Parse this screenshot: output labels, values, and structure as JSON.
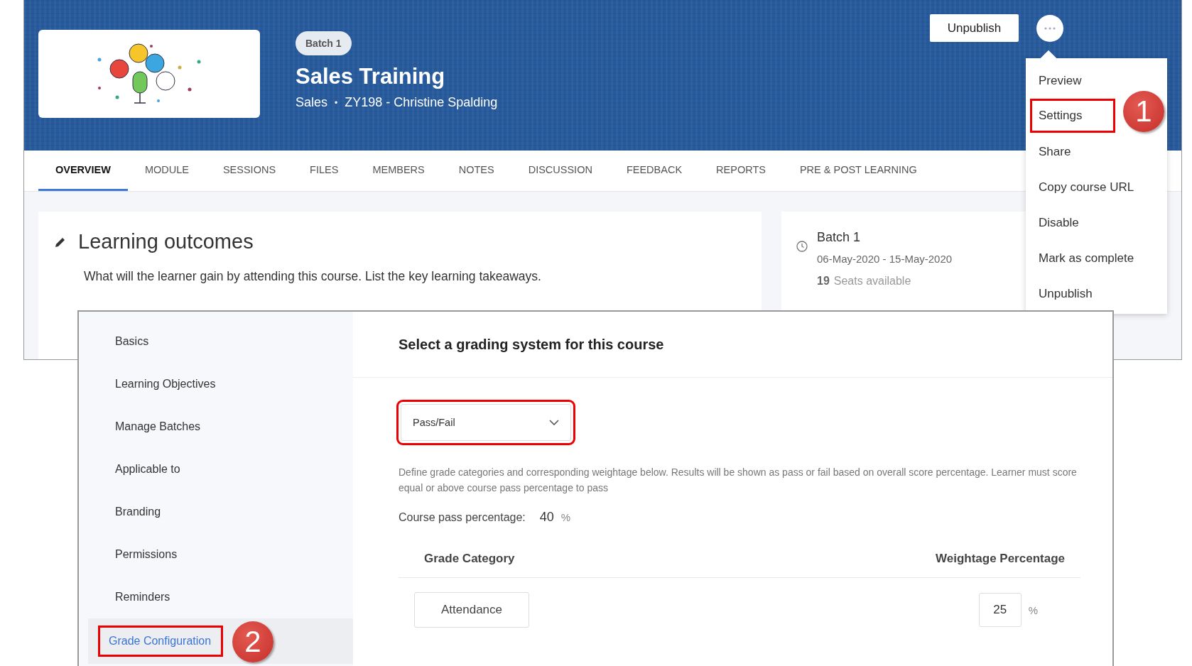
{
  "course_header": {
    "batch_badge": "Batch 1",
    "title": "Sales Training",
    "category": "Sales",
    "separator": "•",
    "code_owner": "ZY198 - Christine Spalding",
    "unpublish_button": "Unpublish"
  },
  "tabs": [
    {
      "label": "OVERVIEW",
      "selected": true
    },
    {
      "label": "MODULE",
      "selected": false
    },
    {
      "label": "SESSIONS",
      "selected": false
    },
    {
      "label": "FILES",
      "selected": false
    },
    {
      "label": "MEMBERS",
      "selected": false
    },
    {
      "label": "NOTES",
      "selected": false
    },
    {
      "label": "DISCUSSION",
      "selected": false
    },
    {
      "label": "FEEDBACK",
      "selected": false
    },
    {
      "label": "REPORTS",
      "selected": false
    },
    {
      "label": "PRE & POST LEARNING",
      "selected": false
    }
  ],
  "learning_outcomes": {
    "title": "Learning outcomes",
    "description": "What will the learner gain by attending this course. List the key learning takeaways."
  },
  "batch_card": {
    "title": "Batch 1",
    "dates": "06-May-2020 - 15-May-2020",
    "seats_count": "19",
    "seats_label": "Seats available"
  },
  "more_menu": {
    "callout": "1",
    "items": [
      {
        "label": "Preview",
        "annotated": false
      },
      {
        "label": "Settings",
        "annotated": true
      },
      {
        "label": "Share",
        "annotated": false
      },
      {
        "label": "Copy course URL",
        "annotated": false
      },
      {
        "label": "Disable",
        "annotated": false
      },
      {
        "label": "Mark as complete",
        "annotated": false
      },
      {
        "label": "Unpublish",
        "annotated": false
      }
    ]
  },
  "settings_sidebar": {
    "callout": "2",
    "items": [
      {
        "label": "Basics",
        "selected": false,
        "annotated": false
      },
      {
        "label": "Learning Objectives",
        "selected": false,
        "annotated": false
      },
      {
        "label": "Manage Batches",
        "selected": false,
        "annotated": false
      },
      {
        "label": "Applicable to",
        "selected": false,
        "annotated": false
      },
      {
        "label": "Branding",
        "selected": false,
        "annotated": false
      },
      {
        "label": "Permissions",
        "selected": false,
        "annotated": false
      },
      {
        "label": "Reminders",
        "selected": false,
        "annotated": false
      },
      {
        "label": "Grade Configuration",
        "selected": true,
        "annotated": true
      }
    ]
  },
  "grading": {
    "heading": "Select a grading system for this course",
    "system_select": {
      "value": "Pass/Fail",
      "annotated": true
    },
    "description": "Define grade categories and corresponding weightage below. Results will be shown as pass or fail based on overall score percentage. Learner must score equal or above course pass percentage to pass",
    "pass_label": "Course pass percentage:",
    "pass_value": "40",
    "pass_unit": "%",
    "columns": [
      "Grade Category",
      "Weightage Percentage"
    ],
    "rows": [
      {
        "category": "Attendance",
        "weight": "25",
        "unit": "%"
      }
    ]
  }
}
